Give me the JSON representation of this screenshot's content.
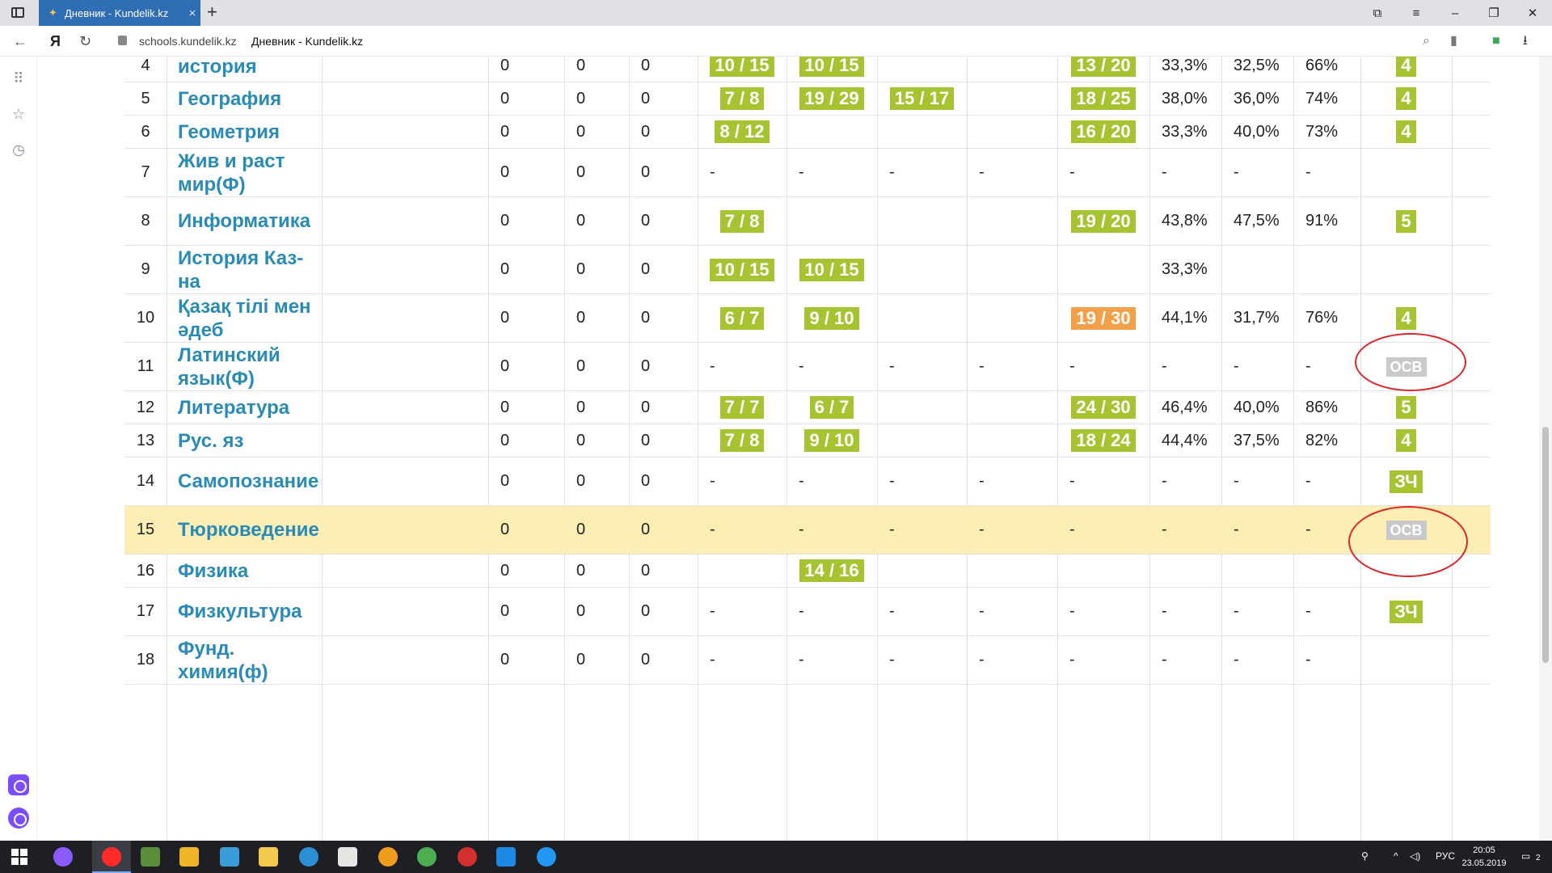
{
  "browser": {
    "tab_title": "Дневник - Kundelik.kz",
    "tab_close": "×",
    "new_tab": "+",
    "logo_letter": "Я",
    "domain": "schools.kundelik.kz",
    "page_title": "Дневник - Kundelik.kz"
  },
  "rows": [
    {
      "n": "4",
      "subject": "история",
      "c1": "0",
      "c2": "0",
      "c3": "0",
      "p1": {
        "t": "10 / 15",
        "k": "green"
      },
      "p2": {
        "t": "10 / 15",
        "k": "green"
      },
      "p3": null,
      "p4": null,
      "p5": {
        "t": "13 / 20",
        "k": "green"
      },
      "s1": "33,3%",
      "s2": "32,5%",
      "s3": "66%",
      "final": {
        "t": "4",
        "k": "green"
      },
      "partial": true
    },
    {
      "n": "5",
      "subject": "География",
      "c1": "0",
      "c2": "0",
      "c3": "0",
      "p1": {
        "t": "7 / 8",
        "k": "green"
      },
      "p2": {
        "t": "19 / 29",
        "k": "green"
      },
      "p3": {
        "t": "15 / 17",
        "k": "green"
      },
      "p4": null,
      "p5": {
        "t": "18 / 25",
        "k": "green"
      },
      "s1": "38,0%",
      "s2": "36,0%",
      "s3": "74%",
      "final": {
        "t": "4",
        "k": "green"
      }
    },
    {
      "n": "6",
      "subject": "Геометрия",
      "c1": "0",
      "c2": "0",
      "c3": "0",
      "p1": {
        "t": "8 / 12",
        "k": "green"
      },
      "p2": null,
      "p3": null,
      "p4": null,
      "p5": {
        "t": "16 / 20",
        "k": "green"
      },
      "s1": "33,3%",
      "s2": "40,0%",
      "s3": "73%",
      "final": {
        "t": "4",
        "k": "green"
      }
    },
    {
      "n": "7",
      "subject": "Жив и раст мир(Ф)",
      "c1": "0",
      "c2": "0",
      "c3": "0",
      "dash": true,
      "final": null
    },
    {
      "n": "8",
      "subject": "Информатика",
      "c1": "0",
      "c2": "0",
      "c3": "0",
      "p1": {
        "t": "7 / 8",
        "k": "green"
      },
      "p2": null,
      "p3": null,
      "p4": null,
      "p5": {
        "t": "19 / 20",
        "k": "green"
      },
      "s1": "43,8%",
      "s2": "47,5%",
      "s3": "91%",
      "final": {
        "t": "5",
        "k": "green"
      }
    },
    {
      "n": "9",
      "subject": "История Каз-на",
      "c1": "0",
      "c2": "0",
      "c3": "0",
      "p1": {
        "t": "10 / 15",
        "k": "green"
      },
      "p2": {
        "t": "10 / 15",
        "k": "green"
      },
      "p3": null,
      "p4": null,
      "p5": null,
      "s1": "33,3%",
      "s2": "",
      "s3": "",
      "final": null
    },
    {
      "n": "10",
      "subject": "Қазақ тілі мен әдеб",
      "c1": "0",
      "c2": "0",
      "c3": "0",
      "p1": {
        "t": "6 / 7",
        "k": "green"
      },
      "p2": {
        "t": "9 / 10",
        "k": "green"
      },
      "p3": null,
      "p4": null,
      "p5": {
        "t": "19 / 30",
        "k": "orange"
      },
      "s1": "44,1%",
      "s2": "31,7%",
      "s3": "76%",
      "final": {
        "t": "4",
        "k": "green"
      }
    },
    {
      "n": "11",
      "subject": "Латинский язык(Ф)",
      "c1": "0",
      "c2": "0",
      "c3": "0",
      "dash": true,
      "final": {
        "t": "ОСВ",
        "k": "grey"
      }
    },
    {
      "n": "12",
      "subject": "Литература",
      "c1": "0",
      "c2": "0",
      "c3": "0",
      "p1": {
        "t": "7 / 7",
        "k": "green"
      },
      "p2": {
        "t": "6 / 7",
        "k": "green"
      },
      "p3": null,
      "p4": null,
      "p5": {
        "t": "24 / 30",
        "k": "green"
      },
      "s1": "46,4%",
      "s2": "40,0%",
      "s3": "86%",
      "final": {
        "t": "5",
        "k": "green"
      }
    },
    {
      "n": "13",
      "subject": "Рус. яз",
      "c1": "0",
      "c2": "0",
      "c3": "0",
      "p1": {
        "t": "7 / 8",
        "k": "green"
      },
      "p2": {
        "t": "9 / 10",
        "k": "green"
      },
      "p3": null,
      "p4": null,
      "p5": {
        "t": "18 / 24",
        "k": "green"
      },
      "s1": "44,4%",
      "s2": "37,5%",
      "s3": "82%",
      "final": {
        "t": "4",
        "k": "green"
      }
    },
    {
      "n": "14",
      "subject": "Самопознание",
      "c1": "0",
      "c2": "0",
      "c3": "0",
      "dash": true,
      "final": {
        "t": "ЗЧ",
        "k": "green"
      }
    },
    {
      "n": "15",
      "subject": "Тюрковедение",
      "c1": "0",
      "c2": "0",
      "c3": "0",
      "dash": true,
      "final": {
        "t": "ОСВ",
        "k": "grey"
      },
      "highlight": true
    },
    {
      "n": "16",
      "subject": "Физика",
      "c1": "0",
      "c2": "0",
      "c3": "0",
      "p1": null,
      "p2": {
        "t": "14 / 16",
        "k": "green"
      },
      "p3": null,
      "p4": null,
      "p5": null,
      "s1": "",
      "s2": "",
      "s3": "",
      "final": null
    },
    {
      "n": "17",
      "subject": "Физкультура",
      "c1": "0",
      "c2": "0",
      "c3": "0",
      "dash": true,
      "final": {
        "t": "ЗЧ",
        "k": "green"
      }
    },
    {
      "n": "18",
      "subject": "Фунд. химия(ф)",
      "c1": "0",
      "c2": "0",
      "c3": "0",
      "dash": true,
      "final": null
    }
  ],
  "dash": "-",
  "taskbar": {
    "lang": "РУС",
    "time": "20:05",
    "date": "23.05.2019",
    "notif_count": "2"
  }
}
